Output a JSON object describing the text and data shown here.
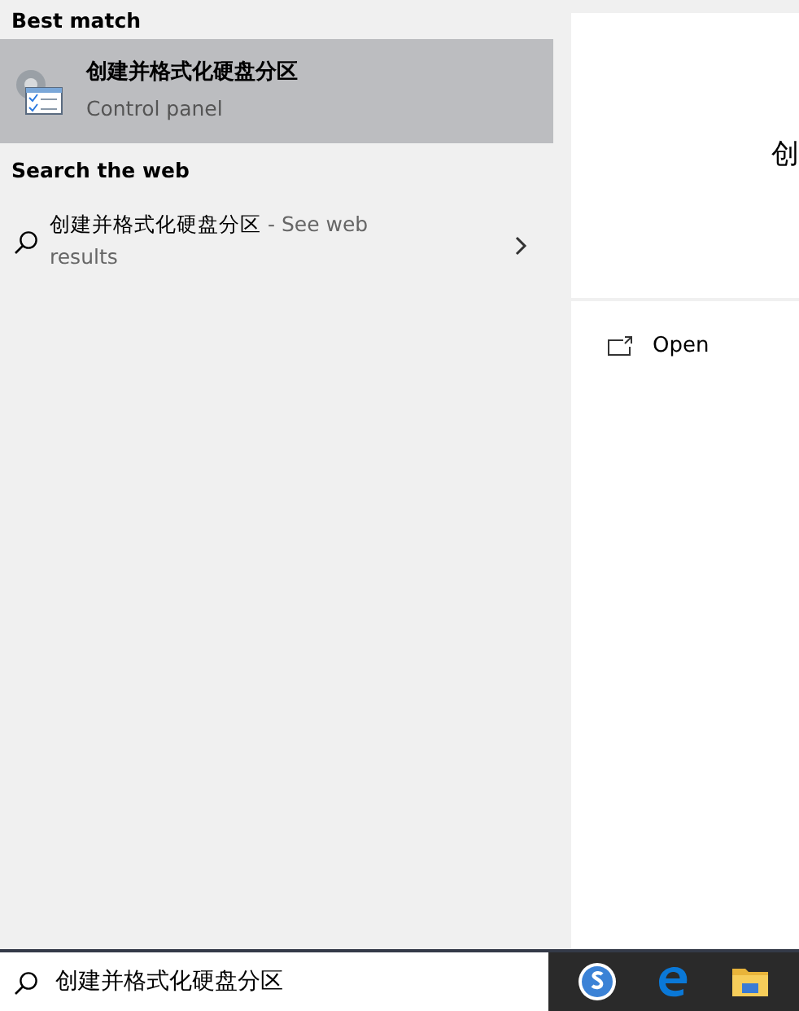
{
  "sections": [
    {
      "heading": "Best match",
      "items": [
        {
          "kind": "app",
          "title": "创建并格式化硬盘分区",
          "subtitle": "Control panel",
          "selected": true
        }
      ]
    },
    {
      "heading": "Search the web",
      "items": [
        {
          "kind": "web",
          "query": "创建并格式化硬盘分区",
          "suffix": " - See web results",
          "selected": false
        }
      ]
    }
  ],
  "preview": {
    "title": "创",
    "actions": [
      {
        "label": "Open"
      }
    ]
  },
  "search": {
    "value": "创建并格式化硬盘分区"
  }
}
